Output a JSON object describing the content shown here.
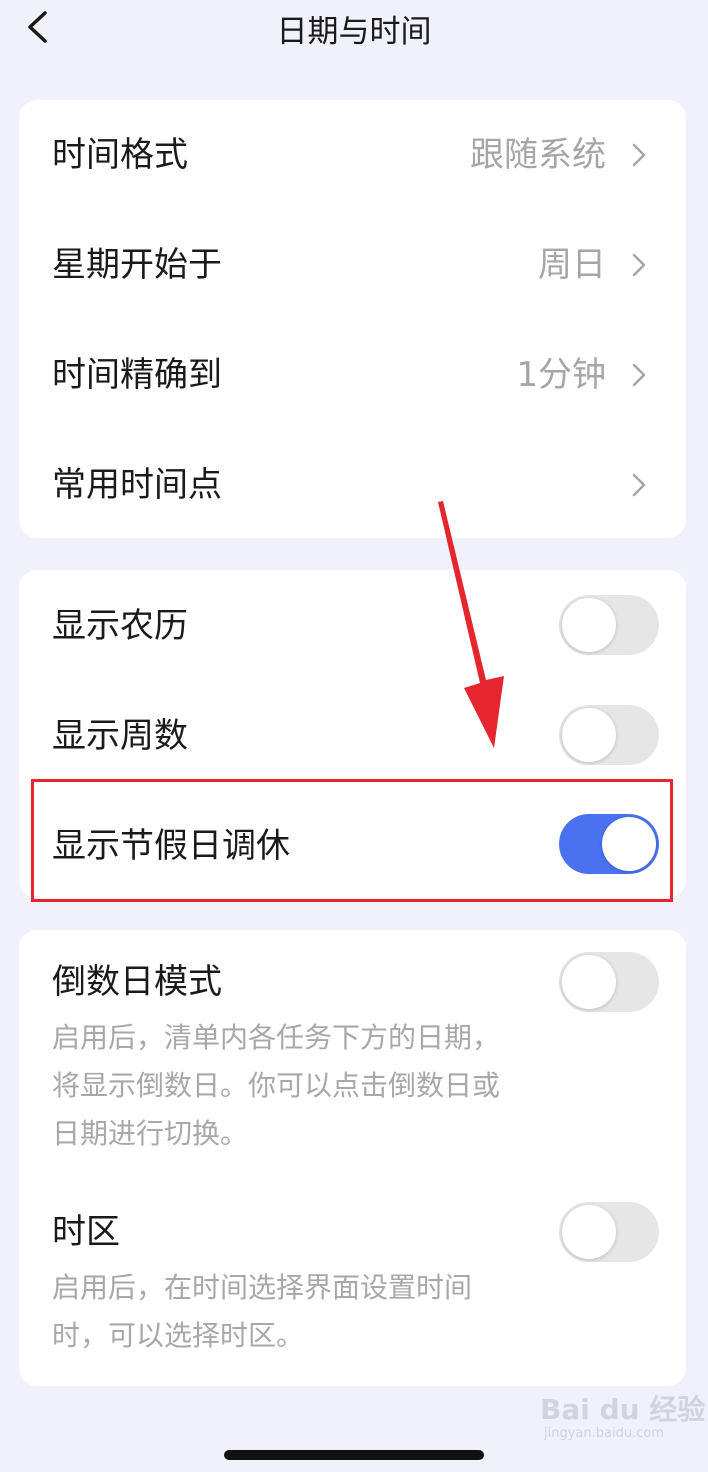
{
  "header": {
    "title": "日期与时间",
    "back_icon": "chevron-left-icon"
  },
  "group1": {
    "rows": [
      {
        "label": "时间格式",
        "value": "跟随系统"
      },
      {
        "label": "星期开始于",
        "value": "周日"
      },
      {
        "label": "时间精确到",
        "value": "1分钟"
      },
      {
        "label": "常用时间点",
        "value": ""
      }
    ]
  },
  "group2": {
    "rows": [
      {
        "label": "显示农历",
        "enabled": false
      },
      {
        "label": "显示周数",
        "enabled": false
      },
      {
        "label": "显示节假日调休",
        "enabled": true
      }
    ]
  },
  "group3": {
    "rows": [
      {
        "label": "倒数日模式",
        "enabled": false,
        "description": "启用后，清单内各任务下方的日期，将显示倒数日。你可以点击倒数日或日期进行切换。"
      },
      {
        "label": "时区",
        "enabled": false,
        "description": "启用后，在时间选择界面设置时间时，可以选择时区。"
      }
    ]
  },
  "watermark": {
    "main": "Bai du 经验",
    "sub": "jingyan.baidu.com"
  },
  "colors": {
    "accent": "#4a72f0",
    "highlight": "#e5262f",
    "background": "#f1f1fb"
  }
}
